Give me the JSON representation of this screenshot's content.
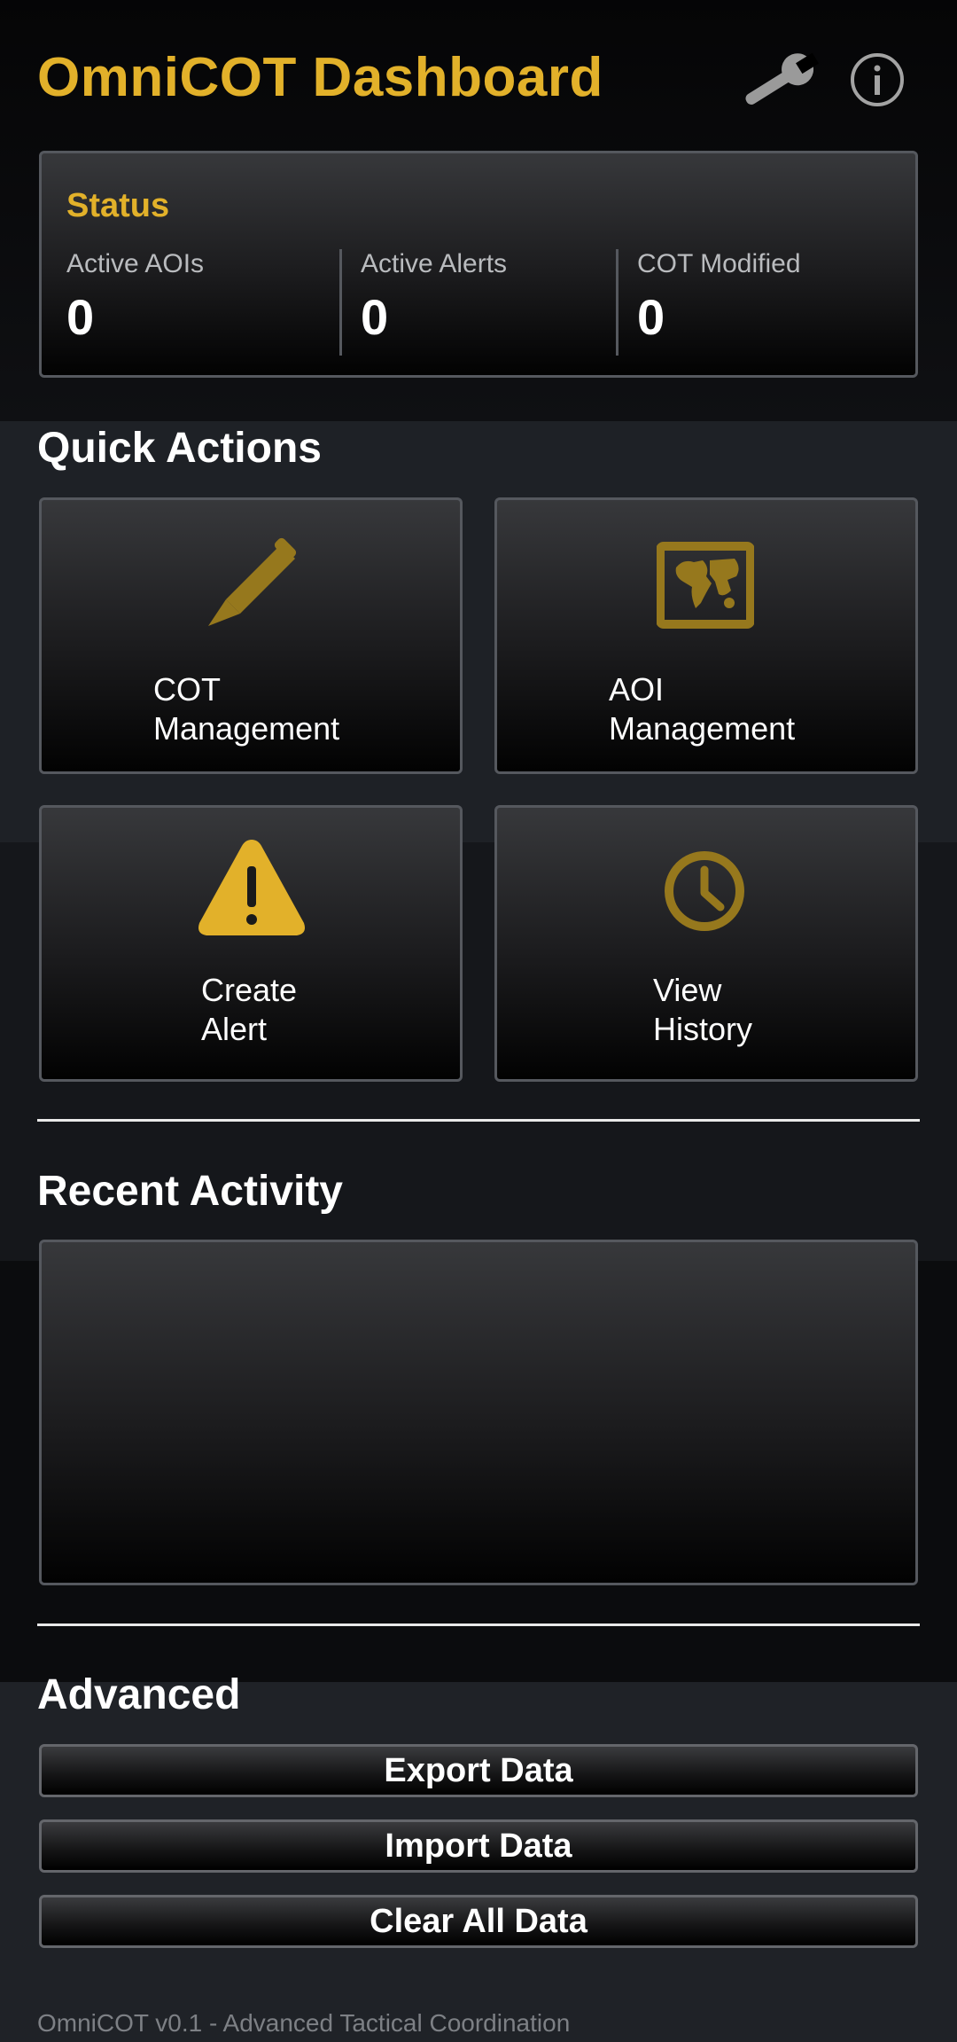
{
  "header": {
    "title": "OmniCOT Dashboard",
    "settings_icon": "wrench-icon",
    "info_icon": "info-icon"
  },
  "status": {
    "title": "Status",
    "stats": [
      {
        "label": "Active AOIs",
        "value": "0"
      },
      {
        "label": "Active Alerts",
        "value": "0"
      },
      {
        "label": "COT Modified",
        "value": "0"
      }
    ]
  },
  "quick_actions": {
    "title": "Quick Actions",
    "tiles": [
      {
        "line1": "COT",
        "line2": "Management",
        "icon": "pencil-icon"
      },
      {
        "line1": "AOI",
        "line2": "Management",
        "icon": "map-icon"
      },
      {
        "line1": "Create",
        "line2": "Alert",
        "icon": "warning-icon"
      },
      {
        "line1": "View",
        "line2": "History",
        "icon": "clock-icon"
      }
    ]
  },
  "recent_activity": {
    "title": "Recent Activity"
  },
  "advanced": {
    "title": "Advanced",
    "export_label": "Export Data",
    "import_label": "Import Data",
    "clear_label": "Clear All Data"
  },
  "footer": {
    "text": "OmniCOT v0.1 - Advanced Tactical Coordination"
  },
  "colors": {
    "accent": "#e2b12a",
    "icon_muted": "#96781d",
    "background": "#0b0c0e"
  }
}
